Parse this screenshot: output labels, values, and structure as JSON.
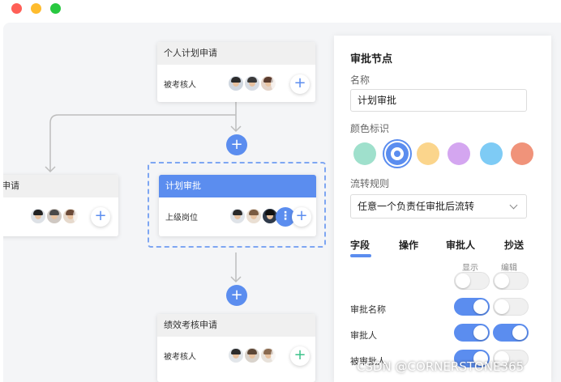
{
  "window": {
    "controls": [
      {
        "name": "close",
        "color": "#ff5f57"
      },
      {
        "name": "minimize",
        "color": "#febc2e"
      },
      {
        "name": "maximize",
        "color": "#28c840"
      }
    ]
  },
  "flow": {
    "node_personal": {
      "title": "个人计划申请",
      "label": "被考核人"
    },
    "node_left": {
      "title": "申请",
      "label": ""
    },
    "node_plan_review": {
      "title": "计划审批",
      "label": "上级岗位"
    },
    "node_performance": {
      "title": "绩效考核申请",
      "label": "被考核人"
    },
    "add_symbol": "+",
    "more_symbol": "⋮"
  },
  "panel": {
    "title": "审批节点",
    "name_label": "名称",
    "name_value": "计划审批",
    "color_label": "颜色标识",
    "colors": [
      "#9fe0cc",
      "#5b8def",
      "#fbd58c",
      "#d4a6f0",
      "#7ecbf5",
      "#f0937a"
    ],
    "selected_color_index": 1,
    "flow_rule_label": "流转规则",
    "flow_rule_value": "任意一个负责任审批后流转",
    "tabs": [
      "字段",
      "操作",
      "审批人",
      "抄送"
    ],
    "active_tab_index": 0,
    "columns": {
      "show": "显示",
      "edit": "编辑"
    },
    "rows": [
      {
        "label": "",
        "show": false,
        "edit": false
      },
      {
        "label": "审批名称",
        "show": true,
        "edit": false
      },
      {
        "label": "审批人",
        "show": true,
        "edit": true
      },
      {
        "label": "被审批人",
        "show": true,
        "edit": false
      }
    ]
  },
  "watermark": "CSDN @CORNERSTONE365"
}
